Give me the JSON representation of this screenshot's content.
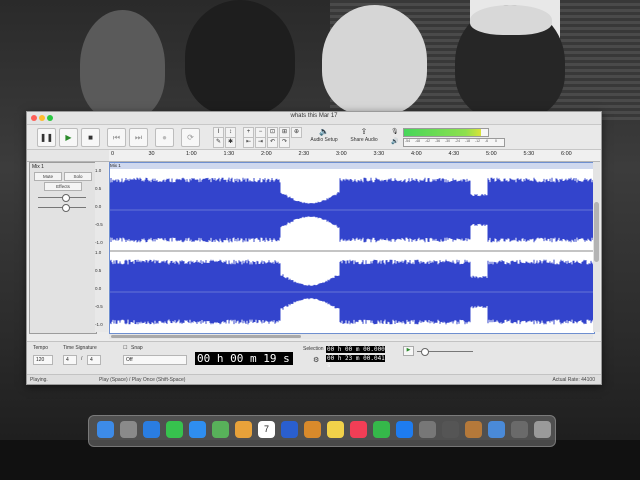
{
  "window": {
    "title": "whats this Mar 17"
  },
  "toolbar": {
    "audio_setup_label": "Audio Setup",
    "share_audio_label": "Share Audio",
    "meter_ticks": [
      "-54",
      "-48",
      "-42",
      "-36",
      "-30",
      "-24",
      "-18",
      "-12",
      "-6",
      "0"
    ],
    "meter_level_fraction": 0.92
  },
  "ruler": {
    "ticks": [
      "0",
      "30",
      "1:00",
      "1:30",
      "2:00",
      "2:30",
      "3:00",
      "3:30",
      "4:00",
      "4:30",
      "5:00",
      "5:30",
      "6:00"
    ]
  },
  "track": {
    "name": "Mix 1",
    "clip_name": "Mix 1",
    "mute_label": "Mute",
    "solo_label": "Solo",
    "effects_label": "Effects",
    "scale_top": [
      "1.0",
      "0.5",
      "0.0",
      "-0.5",
      "-1.0"
    ],
    "scale_bottom": [
      "1.0",
      "0.5",
      "0.0",
      "-0.5",
      "-1.0"
    ],
    "wave_color": "#3344cc"
  },
  "bottom": {
    "tempo_label": "Tempo",
    "tempo_value": "120",
    "time_signature_label": "Time Signature",
    "ts_top": "4",
    "ts_bottom": "4",
    "snap_label": "Snap",
    "snap_value": "Off",
    "audio_position": "00 h 00 m 19 s",
    "selection_label": "Selection",
    "selection_start": "00 h 00 m 00.000 s",
    "selection_end": "00 h 23 m 00.041 s"
  },
  "status": {
    "left": "Playing.",
    "middle": "Play (Space) / Play Once (Shift-Space)",
    "right": "Actual Rate: 44100"
  },
  "dock": {
    "apps": [
      "finder-icon",
      "launchpad-icon",
      "safari-icon",
      "messages-icon",
      "mail-icon",
      "maps-icon",
      "photos-icon",
      "calendar-icon",
      "audacity-icon",
      "app-icon",
      "notes-icon",
      "music-icon",
      "numbers-icon",
      "app-store-icon",
      "settings-icon",
      "app-icon-2",
      "guitar-icon",
      "preview-icon",
      "app-icon-3",
      "trash-icon"
    ],
    "calendar_day": "7"
  }
}
